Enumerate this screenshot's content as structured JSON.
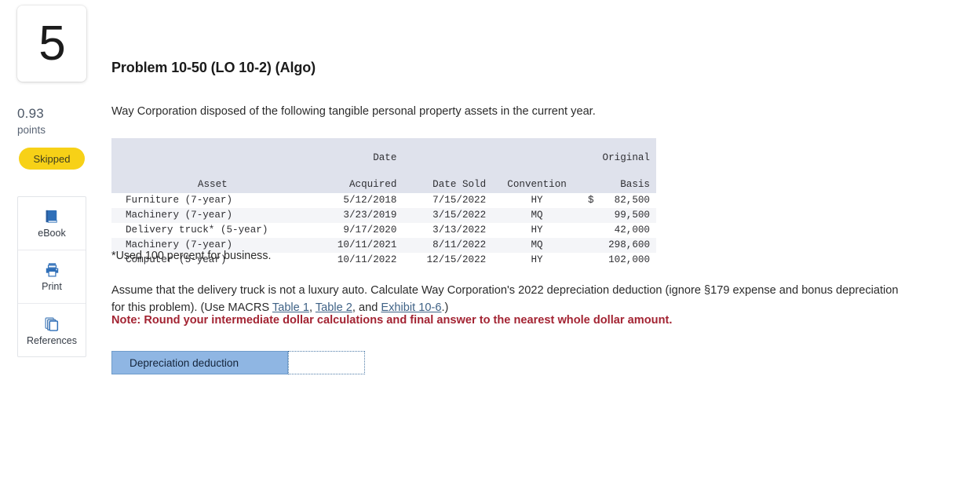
{
  "sidebar": {
    "question_number": "5",
    "points_value": "0.93",
    "points_label": "points",
    "status_badge": "Skipped",
    "badge_color": "#f7d117",
    "tools": [
      {
        "label": "eBook",
        "icon": "book-icon"
      },
      {
        "label": "Print",
        "icon": "printer-icon"
      },
      {
        "label": "References",
        "icon": "pages-stack-icon"
      }
    ]
  },
  "main": {
    "title": "Problem 10-50 (LO 10-2) (Algo)",
    "intro": "Way Corporation disposed of the following tangible personal property assets in the current year.",
    "footnote": "*Used 100 percent for business.",
    "assume_part1": "Assume that the delivery truck is not a luxury auto. Calculate Way Corporation's 2022 depreciation deduction (ignore §179 expense and bonus depreciation for this problem). (Use MACRS ",
    "link1": "Table 1",
    "sep1": ", ",
    "link2": "Table 2",
    "sep2": ", and ",
    "link3": "Exhibit 10-6",
    "assume_end": ".)",
    "note": "Note: Round your intermediate dollar calculations and final answer to the nearest whole dollar amount.",
    "note_color": "#a32433",
    "link_color": "#3f6286"
  },
  "table": {
    "headers": {
      "asset": "Asset",
      "date_acquired_l1": "Date",
      "date_acquired_l2": "Acquired",
      "date_sold": "Date Sold",
      "convention": "Convention",
      "original_basis_l1": "Original",
      "original_basis_l2": "Basis"
    },
    "header_bg": "#dfe2ec",
    "rows": [
      {
        "asset": "Furniture (7-year)",
        "acquired": "5/12/2018",
        "sold": "7/15/2022",
        "convention": "HY",
        "currency": "$",
        "basis": "82,500"
      },
      {
        "asset": "Machinery (7-year)",
        "acquired": "3/23/2019",
        "sold": "3/15/2022",
        "convention": "MQ",
        "currency": "",
        "basis": "99,500"
      },
      {
        "asset": "Delivery truck* (5-year)",
        "acquired": "9/17/2020",
        "sold": "3/13/2022",
        "convention": "HY",
        "currency": "",
        "basis": "42,000"
      },
      {
        "asset": "Machinery (7-year)",
        "acquired": "10/11/2021",
        "sold": "8/11/2022",
        "convention": "MQ",
        "currency": "",
        "basis": "298,600"
      },
      {
        "asset": "Computer (5-year)",
        "acquired": "10/11/2022",
        "sold": "12/15/2022",
        "convention": "HY",
        "currency": "",
        "basis": "102,000"
      }
    ]
  },
  "answer": {
    "label": "Depreciation deduction",
    "value": "",
    "placeholder": "",
    "label_bg": "#8fb6e3"
  }
}
